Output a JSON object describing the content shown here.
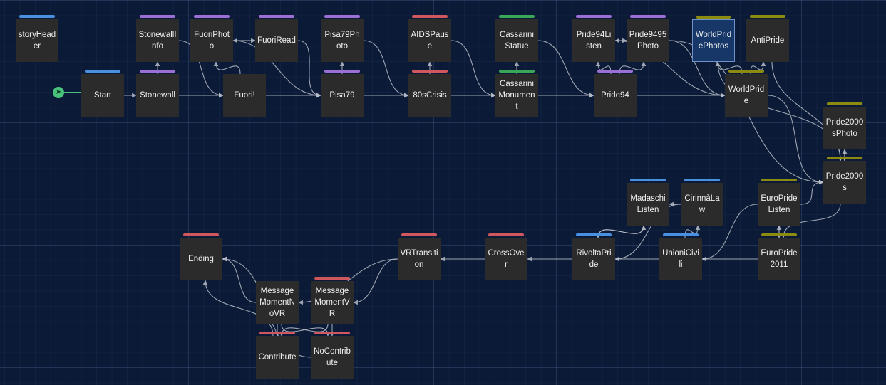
{
  "colors": {
    "background": "#0b1a36",
    "node_fill": "#2b2b2b",
    "selected_fill": "#163768",
    "edge": "#b9bec8",
    "start_marker": "#49c27b",
    "tag_blue": "#4a8fe0",
    "tag_purple": "#9b6fd4",
    "tag_red": "#d0575d",
    "tag_green": "#3aa657",
    "tag_olive": "#8d8a10"
  },
  "start_marker": {
    "icon": "rocket-icon"
  },
  "nodes": [
    {
      "id": "storyHeader",
      "tag": "blue"
    },
    {
      "id": "StonewallInfo",
      "tag": "purple"
    },
    {
      "id": "FuoriPhoto",
      "tag": "purple"
    },
    {
      "id": "FuoriRead",
      "tag": "purple"
    },
    {
      "id": "Pisa79Photo",
      "tag": "purple"
    },
    {
      "id": "AIDSPause",
      "tag": "red"
    },
    {
      "id": "CassariniStatue",
      "tag": "green"
    },
    {
      "id": "Pride94Listen",
      "tag": "purple"
    },
    {
      "id": "Pride9495Photo",
      "tag": "purple"
    },
    {
      "id": "WorldPridePhotos",
      "tag": "olive",
      "selected": true
    },
    {
      "id": "AntiPride",
      "tag": "olive"
    },
    {
      "id": "Start",
      "tag": "blue"
    },
    {
      "id": "Stonewall",
      "tag": "purple"
    },
    {
      "id": "Fuori!",
      "tag": ""
    },
    {
      "id": "Pisa79",
      "tag": "purple"
    },
    {
      "id": "80sCrisis",
      "tag": "red"
    },
    {
      "id": "CassariniMonument",
      "tag": "green"
    },
    {
      "id": "Pride94",
      "tag": "purple"
    },
    {
      "id": "WorldPride",
      "tag": "olive"
    },
    {
      "id": "Pride2000sPhoto",
      "tag": "olive"
    },
    {
      "id": "Pride2000s",
      "tag": "olive"
    },
    {
      "id": "MadaschiListen",
      "tag": "blue"
    },
    {
      "id": "CirinnàLaw",
      "tag": "blue"
    },
    {
      "id": "EuroPrideListen",
      "tag": "olive"
    },
    {
      "id": "Ending",
      "tag": "red"
    },
    {
      "id": "VRTransition",
      "tag": "red"
    },
    {
      "id": "CrossOver",
      "tag": "red"
    },
    {
      "id": "RivoltaPride",
      "tag": "blue"
    },
    {
      "id": "UnioniCivili",
      "tag": "blue"
    },
    {
      "id": "EuroPride2011",
      "tag": "olive"
    },
    {
      "id": "MessageMomentNoVR",
      "tag": ""
    },
    {
      "id": "MessageMomentVR",
      "tag": "red"
    },
    {
      "id": "Contribute",
      "tag": "red"
    },
    {
      "id": "NoContribute",
      "tag": "red"
    }
  ],
  "edges": [
    [
      "Start",
      "Stonewall"
    ],
    [
      "Stonewall",
      "StonewallInfo"
    ],
    [
      "Stonewall",
      "Fuori!"
    ],
    [
      "StonewallInfo",
      "Fuori!"
    ],
    [
      "Fuori!",
      "FuoriPhoto"
    ],
    [
      "FuoriPhoto",
      "FuoriRead"
    ],
    [
      "FuoriRead",
      "FuoriPhoto"
    ],
    [
      "Fuori!",
      "Pisa79"
    ],
    [
      "FuoriPhoto",
      "Pisa79"
    ],
    [
      "FuoriRead",
      "Pisa79"
    ],
    [
      "Pisa79",
      "Pisa79Photo"
    ],
    [
      "Pisa79",
      "80sCrisis"
    ],
    [
      "Pisa79Photo",
      "80sCrisis"
    ],
    [
      "80sCrisis",
      "AIDSPause"
    ],
    [
      "80sCrisis",
      "CassariniMonument"
    ],
    [
      "AIDSPause",
      "CassariniMonument"
    ],
    [
      "CassariniMonument",
      "CassariniStatue"
    ],
    [
      "CassariniMonument",
      "Pride94"
    ],
    [
      "CassariniStatue",
      "Pride94"
    ],
    [
      "Pride94",
      "Pride94Listen"
    ],
    [
      "Pride94",
      "Pride9495Photo"
    ],
    [
      "Pride94Listen",
      "Pride9495Photo"
    ],
    [
      "Pride9495Photo",
      "Pride94Listen"
    ],
    [
      "Pride94",
      "WorldPride"
    ],
    [
      "Pride94Listen",
      "WorldPride"
    ],
    [
      "Pride9495Photo",
      "WorldPride"
    ],
    [
      "WorldPride",
      "WorldPridePhotos"
    ],
    [
      "WorldPride",
      "AntiPride"
    ],
    [
      "WorldPridePhotos",
      "Pride2000s"
    ],
    [
      "AntiPride",
      "Pride2000s"
    ],
    [
      "WorldPride",
      "Pride2000s"
    ],
    [
      "Pride9495Photo",
      "Pride2000s"
    ],
    [
      "Pride2000s",
      "Pride2000sPhoto"
    ],
    [
      "Pride2000sPhoto",
      "Pride2000s"
    ],
    [
      "Pride2000s",
      "EuroPride2011"
    ],
    [
      "EuroPrideListen",
      "Pride2000s"
    ],
    [
      "EuroPride2011",
      "EuroPrideListen"
    ],
    [
      "EuroPrideListen",
      "EuroPride2011"
    ],
    [
      "EuroPride2011",
      "UnioniCivili"
    ],
    [
      "EuroPrideListen",
      "UnioniCivili"
    ],
    [
      "UnioniCivili",
      "CirinnàLaw"
    ],
    [
      "CirinnàLaw",
      "MadaschiListen"
    ],
    [
      "UnioniCivili",
      "RivoltaPride"
    ],
    [
      "CirinnàLaw",
      "RivoltaPride"
    ],
    [
      "MadaschiListen",
      "RivoltaPride"
    ],
    [
      "RivoltaPride",
      "MadaschiListen"
    ],
    [
      "RivoltaPride",
      "CrossOver"
    ],
    [
      "CrossOver",
      "VRTransition"
    ],
    [
      "VRTransition",
      "MessageMomentNoVR"
    ],
    [
      "VRTransition",
      "MessageMomentVR"
    ],
    [
      "MessageMomentNoVR",
      "Ending"
    ],
    [
      "MessageMomentNoVR",
      "Contribute"
    ],
    [
      "MessageMomentNoVR",
      "NoContribute"
    ],
    [
      "MessageMomentVR",
      "Contribute"
    ],
    [
      "MessageMomentVR",
      "NoContribute"
    ],
    [
      "Contribute",
      "Ending"
    ],
    [
      "NoContribute",
      "Ending"
    ]
  ]
}
